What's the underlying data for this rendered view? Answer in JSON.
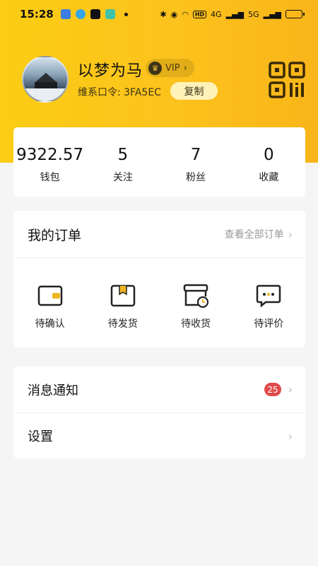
{
  "status_bar": {
    "time": "15:28",
    "signal1": "4G",
    "signal2": "5G",
    "hd": "HD"
  },
  "profile": {
    "name": "以梦为马",
    "vip_label": "VIP",
    "code_line": "维系口令: 3FA5EC",
    "copy_label": "复制"
  },
  "stats": [
    {
      "value": "9322.57",
      "label": "钱包"
    },
    {
      "value": "5",
      "label": "关注"
    },
    {
      "value": "7",
      "label": "粉丝"
    },
    {
      "value": "0",
      "label": "收藏"
    }
  ],
  "orders": {
    "title": "我的订单",
    "view_all": "查看全部订单",
    "items": [
      {
        "label": "待确认",
        "icon": "wallet-icon"
      },
      {
        "label": "待发货",
        "icon": "box-icon"
      },
      {
        "label": "待收货",
        "icon": "package-clock-icon"
      },
      {
        "label": "待评价",
        "icon": "comment-icon"
      }
    ]
  },
  "menu": {
    "messages_label": "消息通知",
    "messages_badge": "25",
    "settings_label": "设置"
  },
  "colors": {
    "brand_yellow": "#fcc21d",
    "badge_red": "#e04a4a",
    "icon_accent": "#f0b623"
  }
}
